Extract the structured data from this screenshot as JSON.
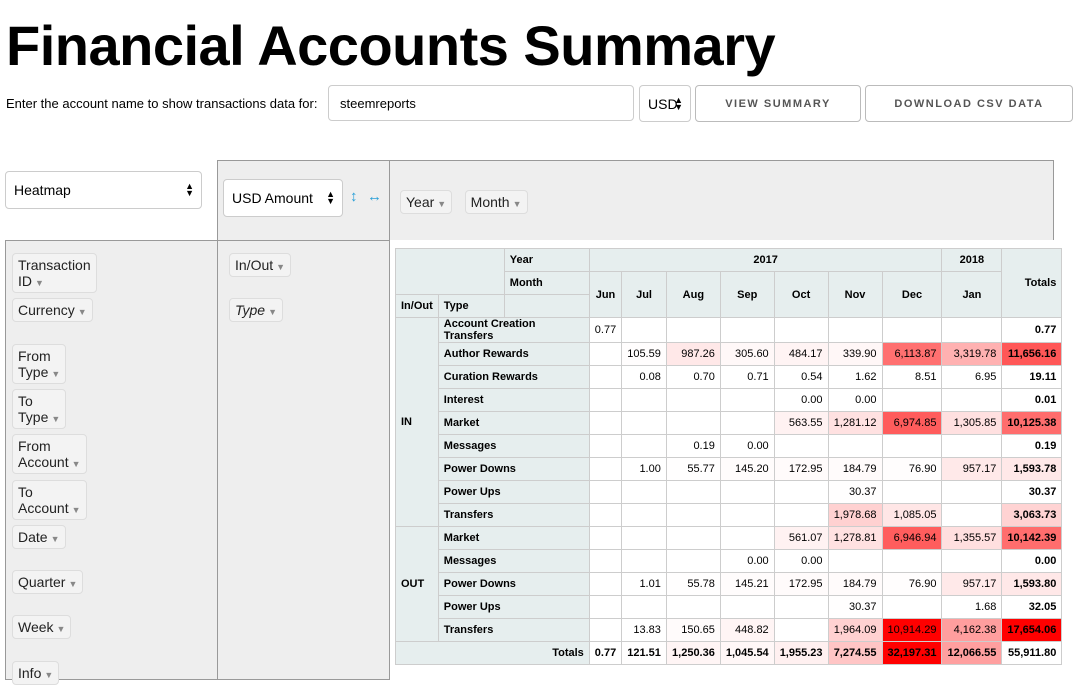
{
  "title": "Financial Accounts Summary",
  "prompt": "Enter the account name to show transactions data for:",
  "account": "steemreports",
  "currency": "USD",
  "view_summary": "VIEW SUMMARY",
  "download_csv": "DOWNLOAD CSV DATA",
  "renderer": "Heatmap",
  "aggregator": "USD Amount",
  "sort_icons": {
    "rows": "↕",
    "cols": "↔"
  },
  "accent": "#2aa0d8",
  "col_fields": [
    "Year",
    "Month"
  ],
  "row_fields": [
    "In/Out",
    "Type"
  ],
  "unused_fields": [
    "Transaction ID",
    "Currency",
    "From Type",
    "To Type",
    "From Account",
    "To Account",
    "Date",
    "Quarter",
    "Week",
    "Info"
  ],
  "table": {
    "year_label": "Year",
    "month_label": "Month",
    "inout_label": "In/Out",
    "type_label": "Type",
    "totals_label": "Totals",
    "years": [
      {
        "label": "2017",
        "span": 7
      },
      {
        "label": "2018",
        "span": 1
      }
    ],
    "months": [
      "Jun",
      "Jul",
      "Aug",
      "Sep",
      "Oct",
      "Nov",
      "Dec",
      "Jan"
    ],
    "groups": [
      {
        "label": "IN",
        "rows": [
          {
            "type": "Account Creation Transfers",
            "values": [
              "0.77",
              null,
              null,
              null,
              null,
              null,
              null,
              null
            ],
            "total": "0.77"
          },
          {
            "type": "Author Rewards",
            "values": [
              null,
              "105.59",
              "987.26",
              "305.60",
              "484.17",
              "339.90",
              "6,113.87",
              "3,319.78"
            ],
            "total": "11,656.16"
          },
          {
            "type": "Curation Rewards",
            "values": [
              null,
              "0.08",
              "0.70",
              "0.71",
              "0.54",
              "1.62",
              "8.51",
              "6.95"
            ],
            "total": "19.11"
          },
          {
            "type": "Interest",
            "values": [
              null,
              null,
              null,
              null,
              "0.00",
              "0.00",
              null,
              null
            ],
            "total": "0.01"
          },
          {
            "type": "Market",
            "values": [
              null,
              null,
              null,
              null,
              "563.55",
              "1,281.12",
              "6,974.85",
              "1,305.85"
            ],
            "total": "10,125.38"
          },
          {
            "type": "Messages",
            "values": [
              null,
              null,
              "0.19",
              "0.00",
              null,
              null,
              null,
              null
            ],
            "total": "0.19"
          },
          {
            "type": "Power Downs",
            "values": [
              null,
              "1.00",
              "55.77",
              "145.20",
              "172.95",
              "184.79",
              "76.90",
              "957.17"
            ],
            "total": "1,593.78"
          },
          {
            "type": "Power Ups",
            "values": [
              null,
              null,
              null,
              null,
              null,
              "30.37",
              null,
              null
            ],
            "total": "30.37"
          },
          {
            "type": "Transfers",
            "values": [
              null,
              null,
              null,
              null,
              null,
              "1,978.68",
              "1,085.05",
              null
            ],
            "total": "3,063.73"
          }
        ]
      },
      {
        "label": "OUT",
        "rows": [
          {
            "type": "Market",
            "values": [
              null,
              null,
              null,
              null,
              "561.07",
              "1,278.81",
              "6,946.94",
              "1,355.57"
            ],
            "total": "10,142.39"
          },
          {
            "type": "Messages",
            "values": [
              null,
              null,
              null,
              "0.00",
              "0.00",
              null,
              null,
              null
            ],
            "total": "0.00"
          },
          {
            "type": "Power Downs",
            "values": [
              null,
              "1.01",
              "55.78",
              "145.21",
              "172.95",
              "184.79",
              "76.90",
              "957.17"
            ],
            "total": "1,593.80"
          },
          {
            "type": "Power Ups",
            "values": [
              null,
              null,
              null,
              null,
              null,
              "30.37",
              null,
              "1.68"
            ],
            "total": "32.05"
          },
          {
            "type": "Transfers",
            "values": [
              null,
              "13.83",
              "150.65",
              "448.82",
              null,
              "1,964.09",
              "10,914.29",
              "4,162.38"
            ],
            "total": "17,654.06"
          }
        ]
      }
    ],
    "col_totals": [
      "0.77",
      "121.51",
      "1,250.36",
      "1,045.54",
      "1,955.23",
      "7,274.55",
      "32,197.31",
      "12,066.55"
    ],
    "grand_total": "55,911.80"
  }
}
